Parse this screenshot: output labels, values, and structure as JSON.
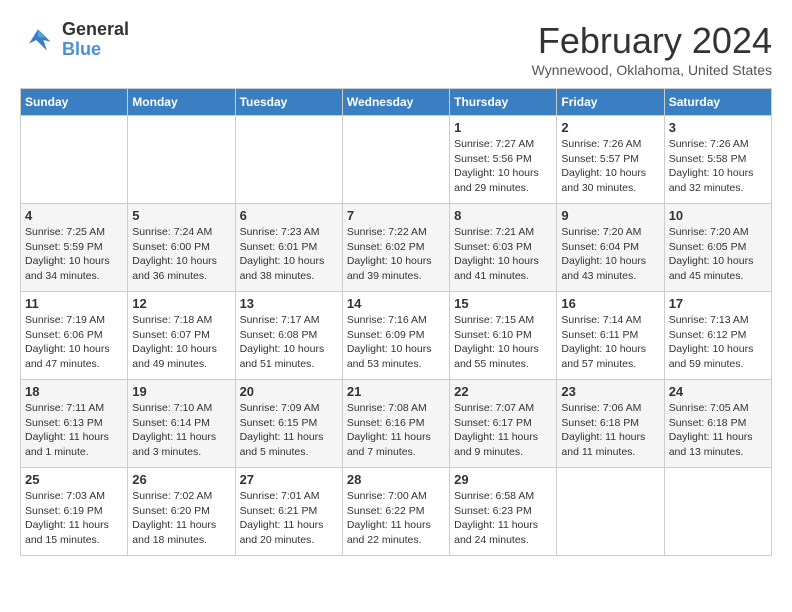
{
  "header": {
    "logo_line1": "General",
    "logo_line2": "Blue",
    "title": "February 2024",
    "location": "Wynnewood, Oklahoma, United States"
  },
  "weekdays": [
    "Sunday",
    "Monday",
    "Tuesday",
    "Wednesday",
    "Thursday",
    "Friday",
    "Saturday"
  ],
  "weeks": [
    [
      {
        "day": "",
        "info": ""
      },
      {
        "day": "",
        "info": ""
      },
      {
        "day": "",
        "info": ""
      },
      {
        "day": "",
        "info": ""
      },
      {
        "day": "1",
        "info": "Sunrise: 7:27 AM\nSunset: 5:56 PM\nDaylight: 10 hours\nand 29 minutes."
      },
      {
        "day": "2",
        "info": "Sunrise: 7:26 AM\nSunset: 5:57 PM\nDaylight: 10 hours\nand 30 minutes."
      },
      {
        "day": "3",
        "info": "Sunrise: 7:26 AM\nSunset: 5:58 PM\nDaylight: 10 hours\nand 32 minutes."
      }
    ],
    [
      {
        "day": "4",
        "info": "Sunrise: 7:25 AM\nSunset: 5:59 PM\nDaylight: 10 hours\nand 34 minutes."
      },
      {
        "day": "5",
        "info": "Sunrise: 7:24 AM\nSunset: 6:00 PM\nDaylight: 10 hours\nand 36 minutes."
      },
      {
        "day": "6",
        "info": "Sunrise: 7:23 AM\nSunset: 6:01 PM\nDaylight: 10 hours\nand 38 minutes."
      },
      {
        "day": "7",
        "info": "Sunrise: 7:22 AM\nSunset: 6:02 PM\nDaylight: 10 hours\nand 39 minutes."
      },
      {
        "day": "8",
        "info": "Sunrise: 7:21 AM\nSunset: 6:03 PM\nDaylight: 10 hours\nand 41 minutes."
      },
      {
        "day": "9",
        "info": "Sunrise: 7:20 AM\nSunset: 6:04 PM\nDaylight: 10 hours\nand 43 minutes."
      },
      {
        "day": "10",
        "info": "Sunrise: 7:20 AM\nSunset: 6:05 PM\nDaylight: 10 hours\nand 45 minutes."
      }
    ],
    [
      {
        "day": "11",
        "info": "Sunrise: 7:19 AM\nSunset: 6:06 PM\nDaylight: 10 hours\nand 47 minutes."
      },
      {
        "day": "12",
        "info": "Sunrise: 7:18 AM\nSunset: 6:07 PM\nDaylight: 10 hours\nand 49 minutes."
      },
      {
        "day": "13",
        "info": "Sunrise: 7:17 AM\nSunset: 6:08 PM\nDaylight: 10 hours\nand 51 minutes."
      },
      {
        "day": "14",
        "info": "Sunrise: 7:16 AM\nSunset: 6:09 PM\nDaylight: 10 hours\nand 53 minutes."
      },
      {
        "day": "15",
        "info": "Sunrise: 7:15 AM\nSunset: 6:10 PM\nDaylight: 10 hours\nand 55 minutes."
      },
      {
        "day": "16",
        "info": "Sunrise: 7:14 AM\nSunset: 6:11 PM\nDaylight: 10 hours\nand 57 minutes."
      },
      {
        "day": "17",
        "info": "Sunrise: 7:13 AM\nSunset: 6:12 PM\nDaylight: 10 hours\nand 59 minutes."
      }
    ],
    [
      {
        "day": "18",
        "info": "Sunrise: 7:11 AM\nSunset: 6:13 PM\nDaylight: 11 hours\nand 1 minute."
      },
      {
        "day": "19",
        "info": "Sunrise: 7:10 AM\nSunset: 6:14 PM\nDaylight: 11 hours\nand 3 minutes."
      },
      {
        "day": "20",
        "info": "Sunrise: 7:09 AM\nSunset: 6:15 PM\nDaylight: 11 hours\nand 5 minutes."
      },
      {
        "day": "21",
        "info": "Sunrise: 7:08 AM\nSunset: 6:16 PM\nDaylight: 11 hours\nand 7 minutes."
      },
      {
        "day": "22",
        "info": "Sunrise: 7:07 AM\nSunset: 6:17 PM\nDaylight: 11 hours\nand 9 minutes."
      },
      {
        "day": "23",
        "info": "Sunrise: 7:06 AM\nSunset: 6:18 PM\nDaylight: 11 hours\nand 11 minutes."
      },
      {
        "day": "24",
        "info": "Sunrise: 7:05 AM\nSunset: 6:18 PM\nDaylight: 11 hours\nand 13 minutes."
      }
    ],
    [
      {
        "day": "25",
        "info": "Sunrise: 7:03 AM\nSunset: 6:19 PM\nDaylight: 11 hours\nand 15 minutes."
      },
      {
        "day": "26",
        "info": "Sunrise: 7:02 AM\nSunset: 6:20 PM\nDaylight: 11 hours\nand 18 minutes."
      },
      {
        "day": "27",
        "info": "Sunrise: 7:01 AM\nSunset: 6:21 PM\nDaylight: 11 hours\nand 20 minutes."
      },
      {
        "day": "28",
        "info": "Sunrise: 7:00 AM\nSunset: 6:22 PM\nDaylight: 11 hours\nand 22 minutes."
      },
      {
        "day": "29",
        "info": "Sunrise: 6:58 AM\nSunset: 6:23 PM\nDaylight: 11 hours\nand 24 minutes."
      },
      {
        "day": "",
        "info": ""
      },
      {
        "day": "",
        "info": ""
      }
    ]
  ]
}
